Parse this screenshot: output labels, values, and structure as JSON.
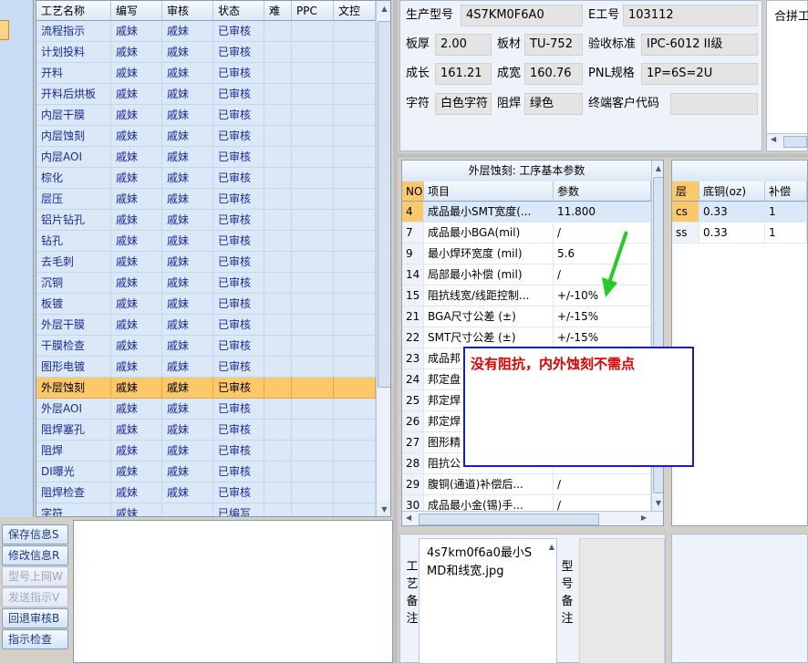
{
  "process_grid": {
    "columns": [
      "工艺名称",
      "编写",
      "审核",
      "状态",
      "难",
      "PPC",
      "文控"
    ],
    "rows": [
      {
        "name": "流程指示",
        "writer": "戚妹",
        "reviewer": "戚妹",
        "status": "已审核"
      },
      {
        "name": "计划投料",
        "writer": "戚妹",
        "reviewer": "戚妹",
        "status": "已审核"
      },
      {
        "name": "开料",
        "writer": "戚妹",
        "reviewer": "戚妹",
        "status": "已审核"
      },
      {
        "name": "开料后烘板",
        "writer": "戚妹",
        "reviewer": "戚妹",
        "status": "已审核"
      },
      {
        "name": "内层干膜",
        "writer": "戚妹",
        "reviewer": "戚妹",
        "status": "已审核"
      },
      {
        "name": "内层蚀刻",
        "writer": "戚妹",
        "reviewer": "戚妹",
        "status": "已审核"
      },
      {
        "name": "内层AOI",
        "writer": "戚妹",
        "reviewer": "戚妹",
        "status": "已审核"
      },
      {
        "name": "棕化",
        "writer": "戚妹",
        "reviewer": "戚妹",
        "status": "已审核"
      },
      {
        "name": "层压",
        "writer": "戚妹",
        "reviewer": "戚妹",
        "status": "已审核"
      },
      {
        "name": "铝片钻孔",
        "writer": "戚妹",
        "reviewer": "戚妹",
        "status": "已审核"
      },
      {
        "name": "钻孔",
        "writer": "戚妹",
        "reviewer": "戚妹",
        "status": "已审核"
      },
      {
        "name": "去毛刺",
        "writer": "戚妹",
        "reviewer": "戚妹",
        "status": "已审核"
      },
      {
        "name": "沉铜",
        "writer": "戚妹",
        "reviewer": "戚妹",
        "status": "已审核"
      },
      {
        "name": "板镀",
        "writer": "戚妹",
        "reviewer": "戚妹",
        "status": "已审核"
      },
      {
        "name": "外层干膜",
        "writer": "戚妹",
        "reviewer": "戚妹",
        "status": "已审核"
      },
      {
        "name": "干膜检查",
        "writer": "戚妹",
        "reviewer": "戚妹",
        "status": "已审核"
      },
      {
        "name": "图形电镀",
        "writer": "戚妹",
        "reviewer": "戚妹",
        "status": "已审核"
      },
      {
        "name": "外层蚀刻",
        "writer": "戚妹",
        "reviewer": "戚妹",
        "status": "已审核"
      },
      {
        "name": "外层AOI",
        "writer": "戚妹",
        "reviewer": "戚妹",
        "status": "已审核"
      },
      {
        "name": "阻焊塞孔",
        "writer": "戚妹",
        "reviewer": "戚妹",
        "status": "已审核"
      },
      {
        "name": "阻焊",
        "writer": "戚妹",
        "reviewer": "戚妹",
        "status": "已审核"
      },
      {
        "name": "DI曝光",
        "writer": "戚妹",
        "reviewer": "戚妹",
        "status": "已审核"
      },
      {
        "name": "阻焊检查",
        "writer": "戚妹",
        "reviewer": "戚妹",
        "status": "已审核"
      },
      {
        "name": "字符",
        "writer": "戚妹",
        "reviewer": "",
        "status": "已编写"
      }
    ],
    "selected_index": 17
  },
  "buttons": [
    {
      "label": "保存信息S",
      "enabled": true
    },
    {
      "label": "修改信息R",
      "enabled": true
    },
    {
      "label": "型号上网W",
      "enabled": false
    },
    {
      "label": "发送指示V",
      "enabled": false
    },
    {
      "label": "回退审核B",
      "enabled": true
    },
    {
      "label": "指示检查",
      "enabled": true
    }
  ],
  "info": {
    "model_label": "生产型号",
    "model": "4S7KM0F6A0",
    "eno_label": "E工号",
    "eno": "103112",
    "thickness_label": "板厚",
    "thickness": "2.00",
    "material_label": "板材",
    "material": "TU-752",
    "standard_label": "验收标准",
    "standard": "IPC-6012 II级",
    "length_label": "成长",
    "length": "161.21",
    "width_label": "成宽",
    "width": "160.76",
    "pnl_label": "PNL规格",
    "pnl": "1P=6S=2U",
    "char_label": "字符",
    "char": "白色字符",
    "mask_label": "阻焊",
    "mask": "绿色",
    "customer_code_label": "终端客户代码",
    "customer_code": ""
  },
  "heban": {
    "title": "合拼工"
  },
  "param_grid": {
    "title": "外层蚀刻: 工序基本参数",
    "columns": [
      "NO",
      "项目",
      "参数"
    ],
    "rows": [
      {
        "no": "4",
        "item": "成品最小SMT宽度(...",
        "value": "11.800"
      },
      {
        "no": "7",
        "item": "成品最小BGA(mil)",
        "value": "/"
      },
      {
        "no": "9",
        "item": "最小焊环宽度 (mil)",
        "value": "5.6"
      },
      {
        "no": "14",
        "item": "局部最小补偿 (mil)",
        "value": "/"
      },
      {
        "no": "15",
        "item": "阻抗线宽/线距控制...",
        "value": "+/-10%"
      },
      {
        "no": "21",
        "item": "BGA尺寸公差 (±)",
        "value": "+/-15%"
      },
      {
        "no": "22",
        "item": "SMT尺寸公差 (±)",
        "value": "+/-15%"
      },
      {
        "no": "23",
        "item": "成品邦",
        "value": ""
      },
      {
        "no": "24",
        "item": "邦定盘",
        "value": ""
      },
      {
        "no": "25",
        "item": "邦定焊",
        "value": ""
      },
      {
        "no": "26",
        "item": "邦定焊",
        "value": ""
      },
      {
        "no": "27",
        "item": "图形精",
        "value": ""
      },
      {
        "no": "28",
        "item": "阻抗公",
        "value": ""
      },
      {
        "no": "29",
        "item": "腹铜(通道)补偿后...",
        "value": "/"
      },
      {
        "no": "30",
        "item": "成品最小金(锡)手...",
        "value": "/"
      }
    ],
    "selected_index": 0
  },
  "layer_grid": {
    "columns": [
      "层",
      "底铜(oz)",
      "补偿"
    ],
    "rows": [
      {
        "layer": "cs",
        "base": "0.33",
        "comp": "1"
      },
      {
        "layer": "ss",
        "base": "0.33",
        "comp": "1"
      }
    ]
  },
  "remark": {
    "craft_label": "工艺备注",
    "craft_text": "4s7km0f6a0最小SMD和线宽.jpg",
    "model_label": "型号备注"
  },
  "callout": {
    "text": "没有阻抗，内外蚀刻不需点"
  },
  "colors": {
    "selection": "#fbc86a",
    "row_bg": "#dbe8f8",
    "link_text": "#1a2a9a",
    "callout_text": "#e00000",
    "callout_border": "#1a1ad0",
    "arrow": "#22cc22"
  }
}
